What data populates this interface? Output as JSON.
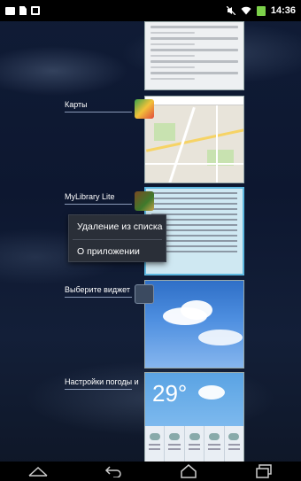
{
  "status_bar": {
    "time": "14:36",
    "left_icons": [
      "photo-icon",
      "document-icon",
      "notes-icon"
    ],
    "right_icons": [
      "mute-icon",
      "wifi-icon",
      "battery-icon"
    ]
  },
  "recent_apps": [
    {
      "label": "",
      "icon": "settings-icon",
      "thumbnail": "settings-screen"
    },
    {
      "label": "Карты",
      "icon": "maps-icon",
      "thumbnail": "map-screen"
    },
    {
      "label": "MyLibrary Lite",
      "icon": "library-icon",
      "thumbnail": "book-page"
    },
    {
      "label": "Выберите виджет",
      "icon": "widget-icon",
      "thumbnail": "weather-sky"
    },
    {
      "label": "Настройки погоды и",
      "icon": "weather-icon",
      "thumbnail": "weather-widget"
    }
  ],
  "context_menu": {
    "items": [
      "Удаление из списка",
      "О приложении"
    ]
  },
  "weather_thumb": {
    "temperature": "29°"
  },
  "nav_bar": {
    "buttons": [
      "up-icon",
      "back-icon",
      "home-icon",
      "recents-icon"
    ]
  },
  "colors": {
    "status_bar": "#000000",
    "battery": "#7cd14a",
    "menu_background": "#2a2f38",
    "selected_border": "#5db8e0"
  }
}
